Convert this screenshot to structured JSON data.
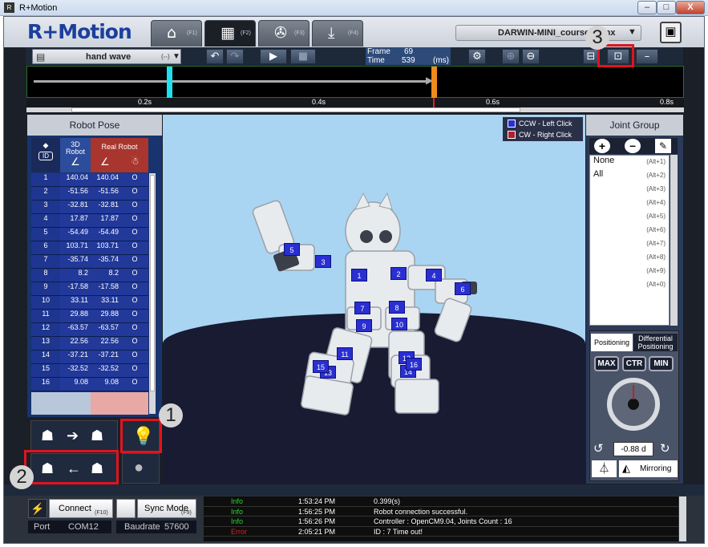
{
  "window": {
    "title": "R+Motion",
    "min": "–",
    "max": "□",
    "close": "X"
  },
  "logo": "R+Motion",
  "tabs": [
    {
      "key": "(F1)",
      "icon": "home-icon"
    },
    {
      "key": "(F2)",
      "icon": "film-icon"
    },
    {
      "key": "(F3)",
      "icon": "reel-icon"
    },
    {
      "key": "(F4)",
      "icon": "download-icon"
    }
  ],
  "model_select": "DARWIN-MINI_course_mtnx",
  "toolbar": {
    "motion_name": "hand wave",
    "motion_suffix": "(--)",
    "frame_label": "Frame",
    "frame_value": "69",
    "time_label": "Time",
    "time_value": "539",
    "time_unit": "(ms)"
  },
  "ruler": [
    "0.2s",
    "0.4s",
    "0.6s",
    "0.8s"
  ],
  "robot_pose": {
    "title": "Robot Pose",
    "col_3d": "3D Robot",
    "col_real": "Real Robot",
    "id_label": "ID",
    "rows": [
      {
        "id": "1",
        "v3d": "140.04",
        "real": "140.04",
        "s": "O"
      },
      {
        "id": "2",
        "v3d": "-51.56",
        "real": "-51.56",
        "s": "O"
      },
      {
        "id": "3",
        "v3d": "-32.81",
        "real": "-32.81",
        "s": "O"
      },
      {
        "id": "4",
        "v3d": "17.87",
        "real": "17.87",
        "s": "O"
      },
      {
        "id": "5",
        "v3d": "-54.49",
        "real": "-54.49",
        "s": "O"
      },
      {
        "id": "6",
        "v3d": "103.71",
        "real": "103.71",
        "s": "O"
      },
      {
        "id": "7",
        "v3d": "-35.74",
        "real": "-35.74",
        "s": "O"
      },
      {
        "id": "8",
        "v3d": "8.2",
        "real": "8.2",
        "s": "O"
      },
      {
        "id": "9",
        "v3d": "-17.58",
        "real": "-17.58",
        "s": "O"
      },
      {
        "id": "10",
        "v3d": "33.11",
        "real": "33.11",
        "s": "O"
      },
      {
        "id": "11",
        "v3d": "29.88",
        "real": "29.88",
        "s": "O"
      },
      {
        "id": "12",
        "v3d": "-63.57",
        "real": "-63.57",
        "s": "O"
      },
      {
        "id": "13",
        "v3d": "22.56",
        "real": "22.56",
        "s": "O"
      },
      {
        "id": "14",
        "v3d": "-37.21",
        "real": "-37.21",
        "s": "O"
      },
      {
        "id": "15",
        "v3d": "-32.52",
        "real": "-32.52",
        "s": "O"
      },
      {
        "id": "16",
        "v3d": "9.08",
        "real": "9.08",
        "s": "O"
      }
    ]
  },
  "viewport": {
    "legend_ccw": "CCW - Left Click",
    "legend_cw": "CW - Right Click",
    "ccw_color": "#2a2fd1",
    "cw_color": "#b0202a",
    "joints": [
      "1",
      "2",
      "3",
      "4",
      "5",
      "6",
      "7",
      "8",
      "9",
      "10",
      "11",
      "12",
      "13",
      "14",
      "15",
      "16"
    ]
  },
  "joint_group": {
    "title": "Joint Group",
    "items": [
      {
        "name": "None",
        "key": "(Alt+1)"
      },
      {
        "name": "All",
        "key": "(Alt+2)"
      },
      {
        "name": "",
        "key": "(Alt+3)"
      },
      {
        "name": "",
        "key": "(Alt+4)"
      },
      {
        "name": "",
        "key": "(Alt+5)"
      },
      {
        "name": "",
        "key": "(Alt+6)"
      },
      {
        "name": "",
        "key": "(Alt+7)"
      },
      {
        "name": "",
        "key": "(Alt+8)"
      },
      {
        "name": "",
        "key": "(Alt+9)"
      },
      {
        "name": "",
        "key": "(Alt+0)"
      }
    ]
  },
  "positioning": {
    "tab_positioning": "Positioning",
    "tab_differential": "Differential Positioning",
    "max": "MAX",
    "ctr": "CTR",
    "min": "MIN",
    "value": "-0.88 d",
    "mirroring": "Mirroring"
  },
  "bottom": {
    "connect": "Connect",
    "connect_key": "(F10)",
    "sync_mode": "Sync Mode",
    "sync_key": "(F9)",
    "port_label": "Port",
    "port_value": "COM12",
    "baud_label": "Baudrate",
    "baud_value": "57600"
  },
  "log": [
    {
      "level": "Info",
      "time": "1:53:24 PM",
      "msg": "0.399(s)"
    },
    {
      "level": "Info",
      "time": "1:56:25 PM",
      "msg": "Robot connection successful."
    },
    {
      "level": "Info",
      "time": "1:56:26 PM",
      "msg": "Controller : OpenCM9.04, Joints Count : 16"
    },
    {
      "level": "Error",
      "time": "2:05:21 PM",
      "msg": "ID : 7 Time out!"
    }
  ],
  "annotations": [
    "1",
    "2",
    "3"
  ]
}
